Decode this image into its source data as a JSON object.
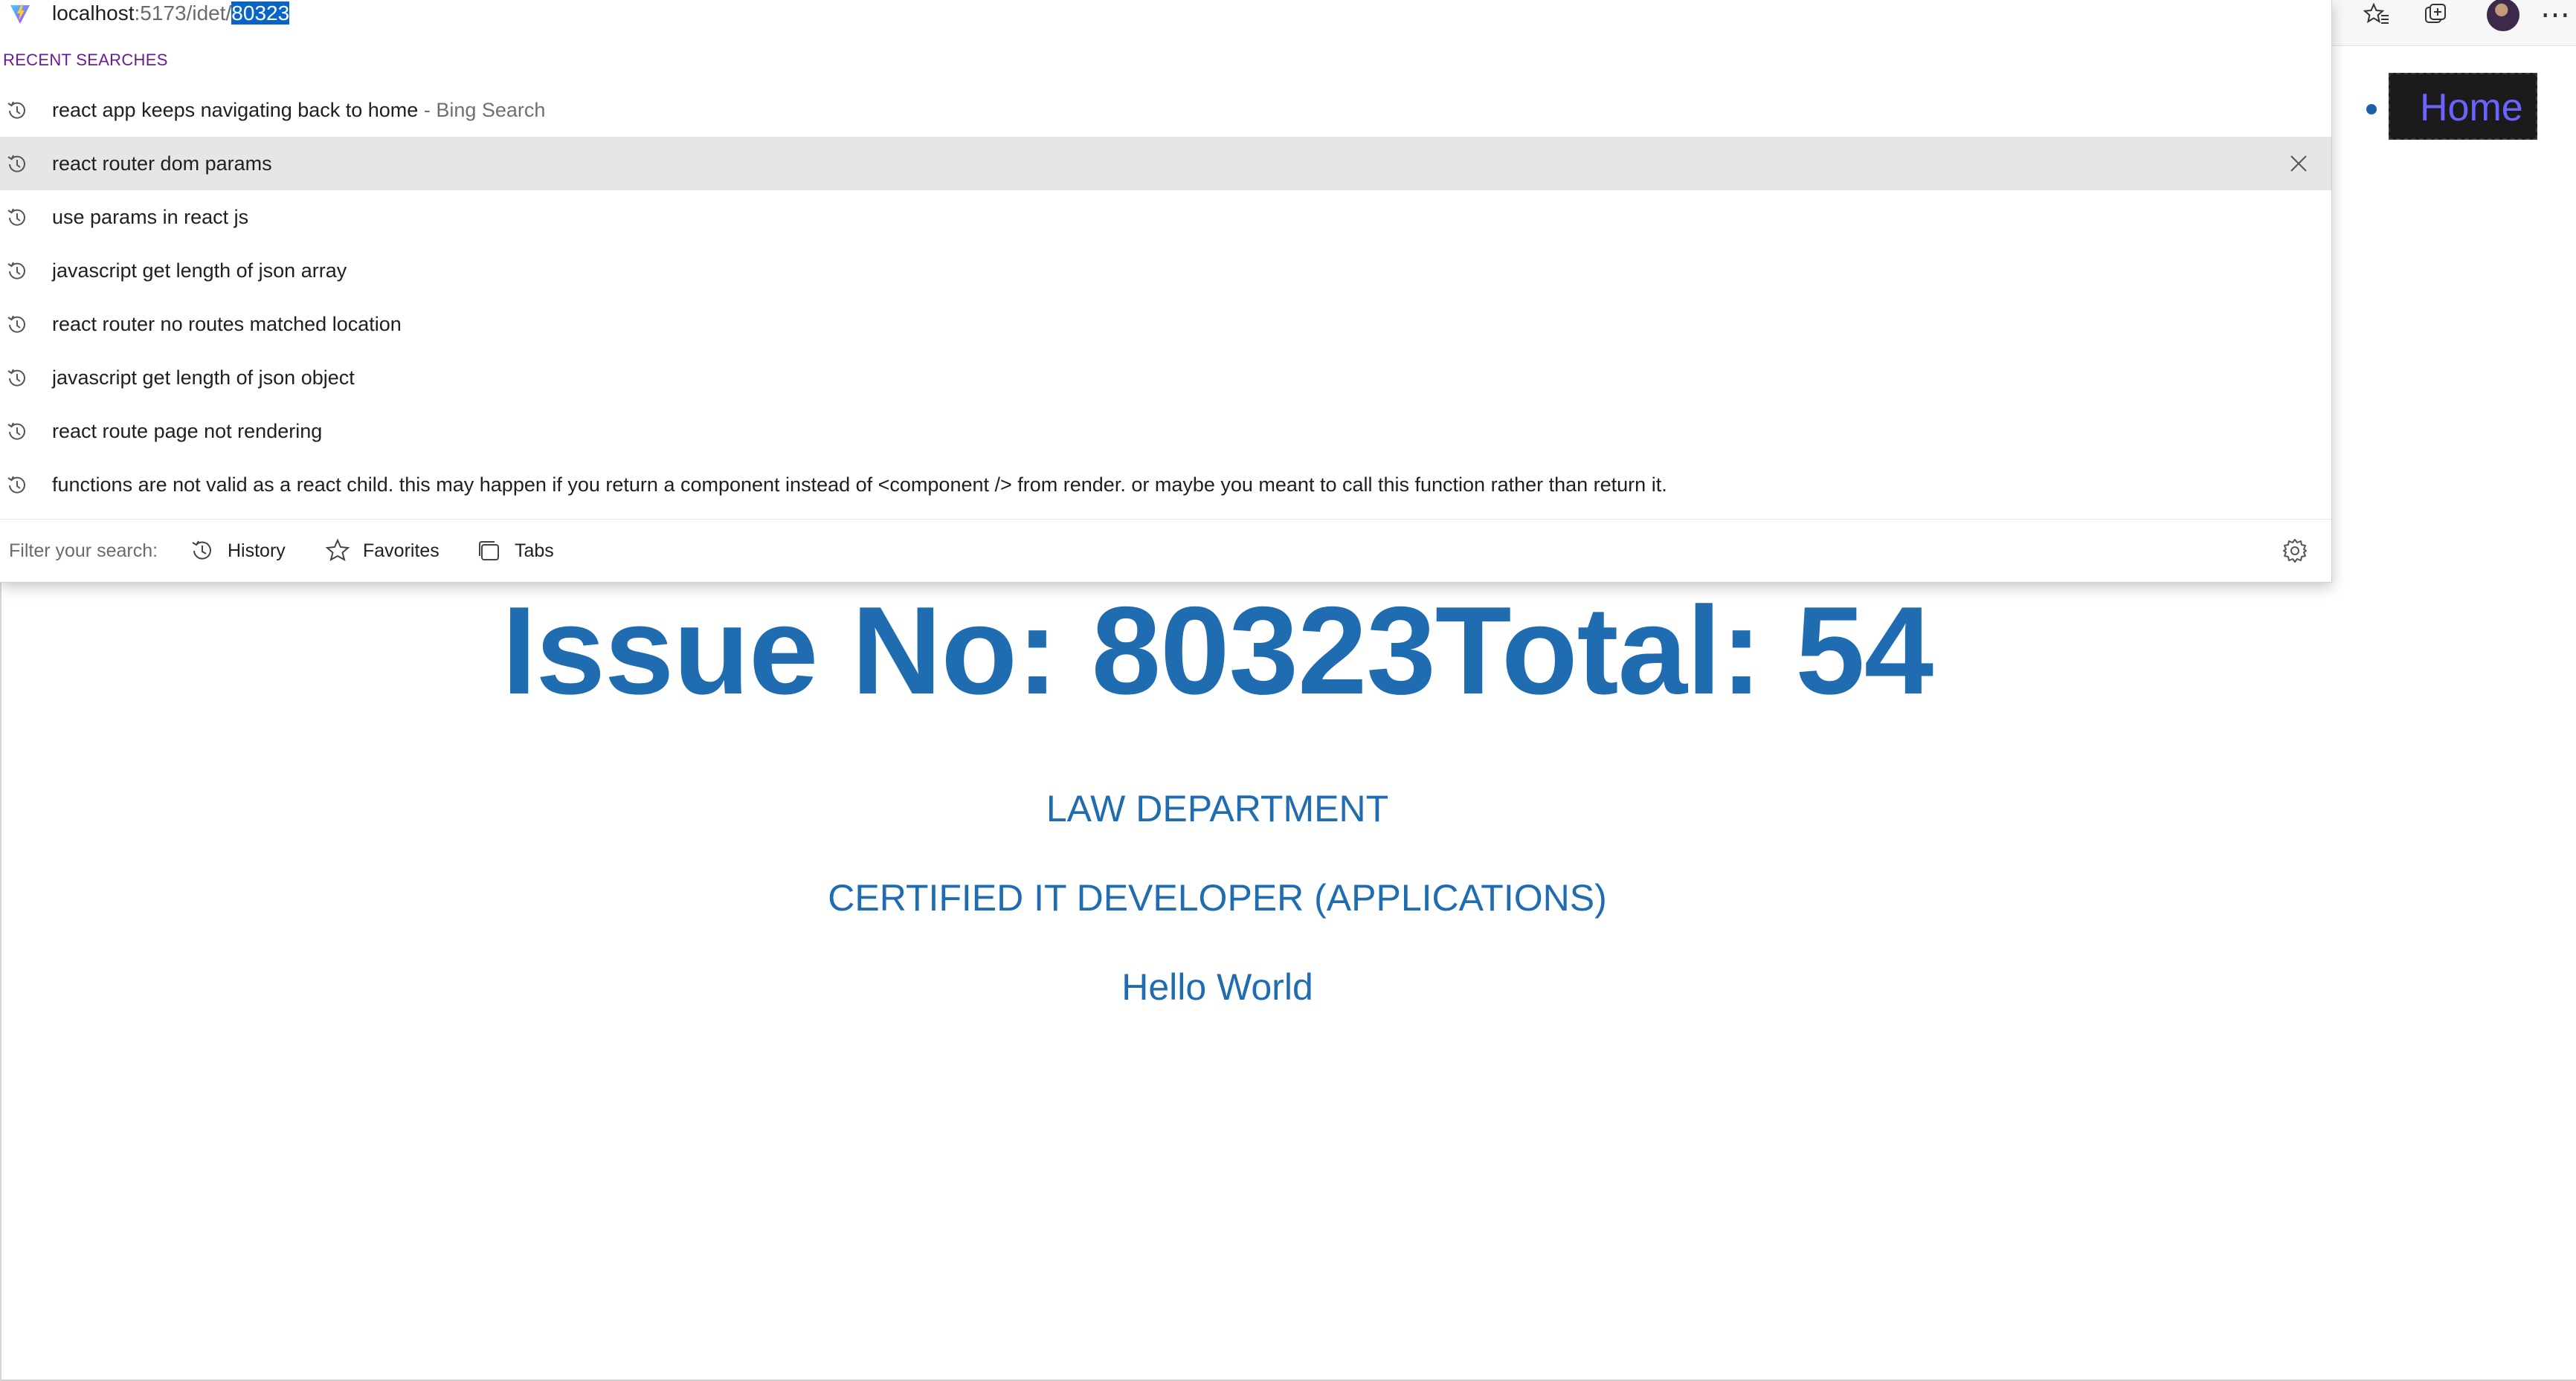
{
  "browser": {
    "address_bar": {
      "host": "localhost",
      "path": ":5173/idet/",
      "selected": "80323"
    },
    "dropdown": {
      "section_label": "RECENT SEARCHES",
      "suggestions": [
        {
          "text": "react app keeps navigating back to home",
          "source": " - Bing Search"
        },
        {
          "text": "react router dom params",
          "source": ""
        },
        {
          "text": "use params in react js",
          "source": ""
        },
        {
          "text": "javascript get length of json array",
          "source": ""
        },
        {
          "text": "react router no routes matched location",
          "source": ""
        },
        {
          "text": "javascript get length of json object",
          "source": ""
        },
        {
          "text": "react route page not rendering",
          "source": ""
        },
        {
          "text": "functions are not valid as a react child. this may happen if you return a component instead of <component /> from render. or maybe you meant to call this function rather than return it.",
          "source": ""
        }
      ],
      "highlighted_index": 1,
      "filter": {
        "label": "Filter your search:",
        "history": "History",
        "favorites": "Favorites",
        "tabs": "Tabs"
      }
    },
    "toolbar_icons": [
      "favorites-icon",
      "collections-icon",
      "profile-avatar",
      "more-icon"
    ]
  },
  "page": {
    "nav": {
      "home_label": "Home"
    },
    "heading": "Issue No: 80323Total: 54",
    "department": "LAW DEPARTMENT",
    "job_title": "CERTIFIED IT DEVELOPER (APPLICATIONS)",
    "greeting": "Hello World"
  },
  "colors": {
    "content_blue": "#1f6cb1",
    "selection_blue": "#0a64c8",
    "section_label_purple": "#6a1b9a",
    "home_link_text": "#6a63ff",
    "home_link_bg": "#1b1b1b"
  }
}
